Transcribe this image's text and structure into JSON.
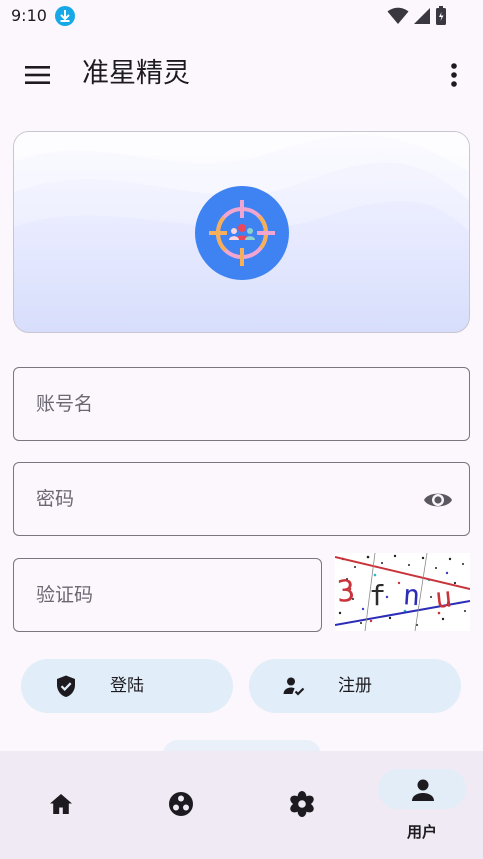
{
  "status_bar": {
    "time": "9:10",
    "icons": [
      "download-icon",
      "wifi-icon",
      "signal-icon",
      "battery-icon"
    ]
  },
  "app_bar": {
    "title": "准星精灵",
    "menu_icon": "menu-icon",
    "more_icon": "more-vert-icon"
  },
  "form": {
    "account": {
      "placeholder": "账号名",
      "value": ""
    },
    "password": {
      "placeholder": "密码",
      "value": ""
    },
    "captcha": {
      "placeholder": "验证码",
      "value": ""
    },
    "captcha_image_text": "3fnu"
  },
  "actions": {
    "login_label": "登陆",
    "register_label": "注册"
  },
  "bottom_nav": {
    "items": [
      {
        "icon": "home-icon",
        "label": ""
      },
      {
        "icon": "games-icon",
        "label": ""
      },
      {
        "icon": "settings-icon",
        "label": ""
      },
      {
        "icon": "person-icon",
        "label": "用户",
        "selected": true
      }
    ]
  },
  "colors": {
    "background": "#FCF7FC",
    "logo": "#3F82F1",
    "button": "#E1EDF8",
    "nav_bar": "#EFEAF3"
  }
}
